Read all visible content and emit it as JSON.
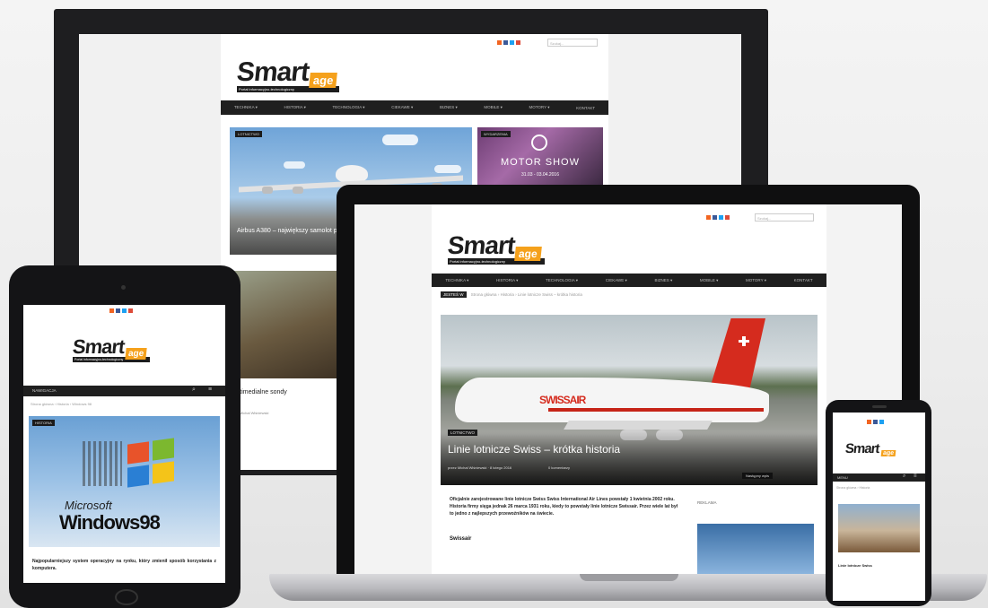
{
  "brand": {
    "name": "Smart",
    "suffix": "age",
    "tagline": "Portal informacyjno-technologiczny"
  },
  "nav": {
    "items": [
      "TECHNIKA ▾",
      "HISTORIA ▾",
      "TECHNOLOGIA ▾",
      "CIEKAWE ▾",
      "BIZNES ▾",
      "MOBILE ▾",
      "MOTORY ▾",
      "KONTAKT"
    ]
  },
  "search": {
    "placeholder": "Szukaj..."
  },
  "monitor": {
    "hero_badge": "LOTNICTWO",
    "hero_title": "Airbus A380 – największy samolot pasażerski",
    "side_badge": "WYDARZENIA",
    "side_title": "MOTOR SHOW",
    "side_dates": "31.03 - 03.04.2016",
    "lower_title": "Multimedialne sondy",
    "lower_meta": "przez Michał Wiśniewski"
  },
  "laptop": {
    "breadcrumb": {
      "label": "JESTEŚ W",
      "items": [
        "Strona główna",
        "Historia",
        "Linie lotnicze Swiss – krótka historia"
      ]
    },
    "hero": {
      "badge": "LOTNICTWO",
      "title": "Linie lotnicze Swiss – krótka historia",
      "meta": "przez Michał Wiśniewski · 8 lutego 2016",
      "comments": "0 komentarzy",
      "next": "Następny wpis"
    },
    "paragraph": "Oficjalnie zarejestrowane linie lotnicze Swiss Swiss International Air Lines powstały 1 kwietnia 2002 roku. Historia firmy sięga jednak 26 marca 1931 roku, kiedy to powstały linie lotnicze Swissair. Przez wiele lat był to jedno z najlepszych przewoźników na świecie.",
    "subheading": "Swissair",
    "sidebar_heading": "REKLAMA"
  },
  "tablet": {
    "menu_label": "NAWIGACJA",
    "breadcrumb": "Strona główna › Historia › Windows 98",
    "featured_badge": "HISTORIA",
    "brand_text": "Microsoft",
    "product_text": "Windows98",
    "body_text": "Najpopularniejszy system operacyjny na rynku, który zmienił sposób korzystania z komputera."
  },
  "phone": {
    "menu_label": "MENU",
    "breadcrumb": "Strona główna › Historia",
    "body_text": "Linie lotnicze Swiss"
  },
  "colors": {
    "accent": "#f5a11c",
    "dark": "#1f1f1f",
    "swiss_red": "#d52b1e"
  }
}
